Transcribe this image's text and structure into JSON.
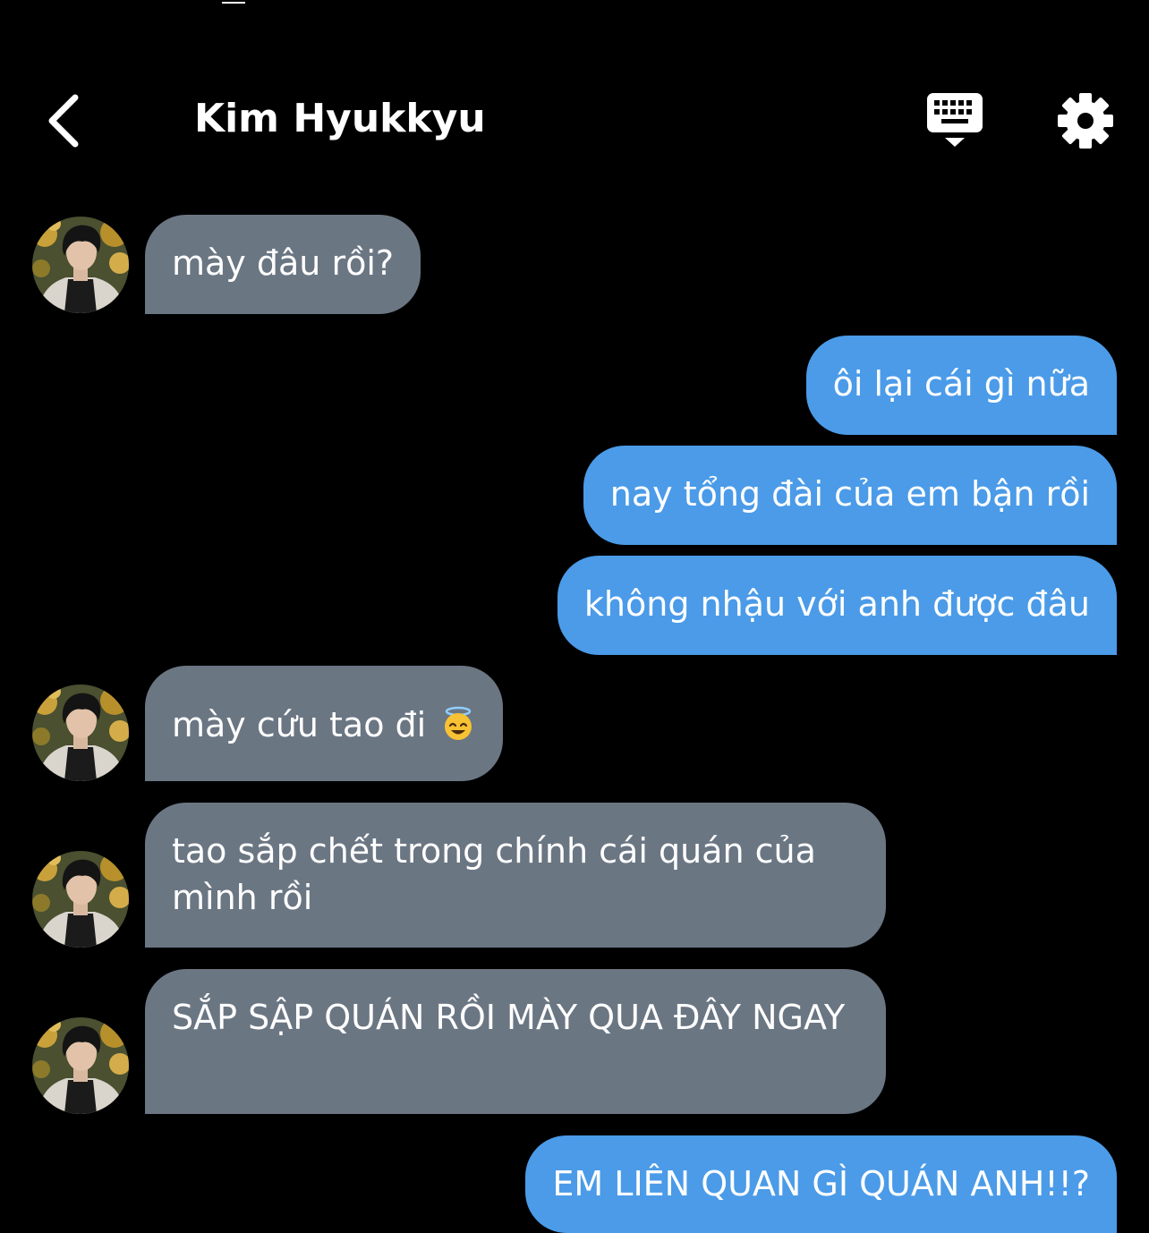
{
  "header": {
    "title": "Kim Hyukkyu"
  },
  "icons": {
    "back": "chevron-left-icon",
    "keyboard": "keyboard-icon",
    "settings": "gear-icon",
    "emoji": "smiling-face-with-halo"
  },
  "colors": {
    "background": "#000000",
    "incoming_bubble": "#6b7683",
    "outgoing_bubble": "#4b9be8",
    "text": "#ffffff"
  },
  "messages": [
    {
      "sender": "contact",
      "text": "mày đâu rồi?"
    },
    {
      "sender": "me",
      "text": "ôi lại cái gì nữa"
    },
    {
      "sender": "me",
      "text": "nay tổng đài của em bận rồi"
    },
    {
      "sender": "me",
      "text": "không nhậu với anh được đâu"
    },
    {
      "sender": "contact",
      "text": "mày cứu tao đi",
      "emoji": "smiling-face-with-halo"
    },
    {
      "sender": "contact",
      "text": "tao sắp chết trong chính cái quán của mình rồi"
    },
    {
      "sender": "contact",
      "text": "SẮP SẬP QUÁN RỒI MÀY QUA ĐÂY NGAY"
    },
    {
      "sender": "me",
      "text": "EM LIÊN QUAN GÌ QUÁN ANH!!?"
    }
  ]
}
